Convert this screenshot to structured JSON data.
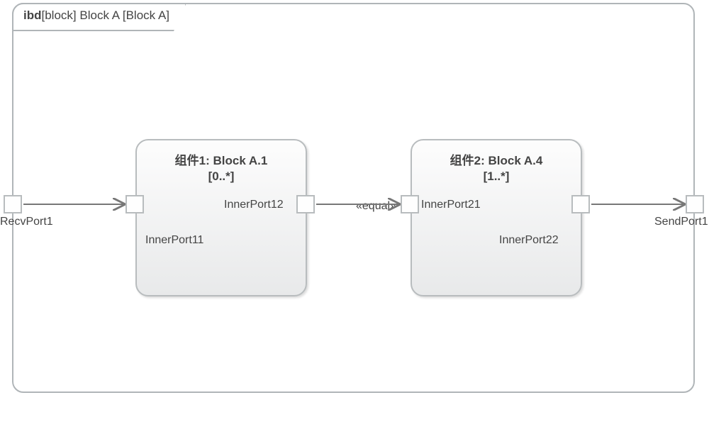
{
  "frame": {
    "kind": "ibd",
    "stereotype": "[block]",
    "name": "Block A",
    "bracket_name": "[Block A]"
  },
  "outer_ports": {
    "recv": {
      "name": "RecvPort1"
    },
    "send": {
      "name": "SendPort1"
    }
  },
  "blocks": [
    {
      "id": "block1",
      "title_prefix": "组件1:",
      "title_type": "Block A.1",
      "multiplicity": "[0..*]",
      "ports": {
        "left": {
          "name": "InnerPort11"
        },
        "right": {
          "name": "InnerPort12"
        }
      }
    },
    {
      "id": "block2",
      "title_prefix": "组件2:",
      "title_type": "Block A.4",
      "multiplicity": "[1..*]",
      "ports": {
        "left": {
          "name": "InnerPort21"
        },
        "right": {
          "name": "InnerPort22"
        }
      }
    }
  ],
  "connectors": [
    {
      "from": "RecvPort1",
      "to": "InnerPort11",
      "stereotype": null
    },
    {
      "from": "InnerPort12",
      "to": "InnerPort21",
      "stereotype": "«equal»"
    },
    {
      "from": "InnerPort22",
      "to": "SendPort1",
      "stereotype": null
    }
  ],
  "labels": {
    "equal_stereotype": "«equal»"
  }
}
